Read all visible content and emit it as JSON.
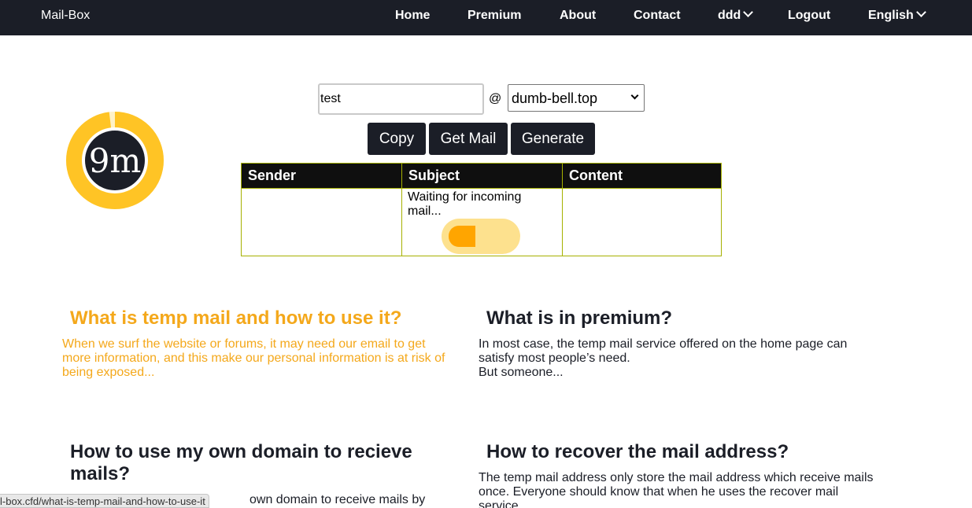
{
  "nav": {
    "brand": "Mail-Box",
    "items": [
      {
        "label": "Home"
      },
      {
        "label": "Premium"
      },
      {
        "label": "About"
      },
      {
        "label": "Contact"
      },
      {
        "label": "ddd"
      },
      {
        "label": "Logout"
      },
      {
        "label": "English"
      }
    ]
  },
  "timer": {
    "text": "9m",
    "ring_color": "#ffc425",
    "track_color": "#fff2c7",
    "center_color": "#1b1e27",
    "fraction_remaining": 0.98
  },
  "form": {
    "name_value": "test",
    "at": "@",
    "domain_selected": "dumb-bell.top",
    "buttons": {
      "copy": "Copy",
      "get_mail": "Get Mail",
      "generate": "Generate"
    }
  },
  "inbox": {
    "headers": [
      "Sender",
      "Subject",
      "Content"
    ],
    "waiting_text": "Waiting for incoming mail..."
  },
  "articles": [
    {
      "title": "What is temp mail and how to use it?",
      "body": "When we surf the website or forums, it may need our email to get more information, and this make our personal information is at risk of being exposed..."
    },
    {
      "title": "What is in premium?",
      "body": "In most case, the temp mail service offered on the home page can satisfy most people’s need.",
      "body2": "But someone..."
    },
    {
      "title": "How to use my own domain to recieve mails?",
      "body": "own domain to receive mails by"
    },
    {
      "title": "How to recover the mail address?",
      "body": "The temp mail address only store the mail address which receive mails once. Everyone should know that when he uses the recover mail service"
    }
  ],
  "status_bar": {
    "url": "l-box.cfd/what-is-temp-mail-and-how-to-use-it"
  },
  "colors": {
    "nav_bg": "#1b1e27",
    "accent": "#f4a81b",
    "table_border": "#a6b100"
  }
}
